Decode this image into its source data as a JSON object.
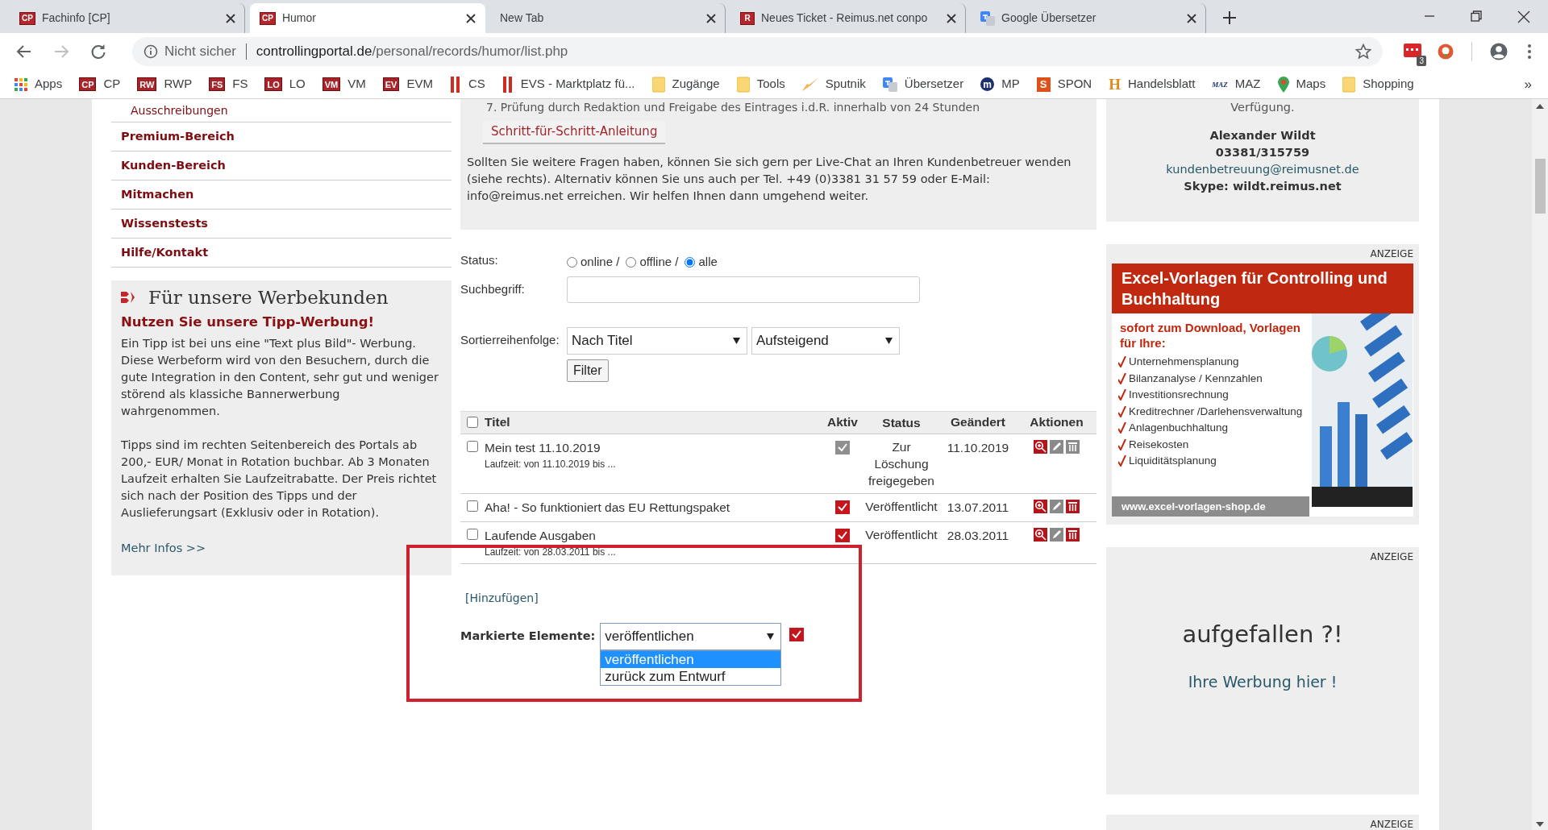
{
  "browser": {
    "tabs": [
      {
        "title": "Fachinfo [CP]",
        "kind": "badge",
        "favicon_text": "CP",
        "selected": false
      },
      {
        "title": "Humor",
        "kind": "badge",
        "favicon_text": "CP",
        "selected": true
      },
      {
        "title": "New Tab",
        "kind": "plain",
        "selected": false
      },
      {
        "title": "Neues Ticket - Reimus.net conpo",
        "kind": "badge",
        "favicon_text": "R",
        "selected": false
      },
      {
        "title": "Google Übersetzer",
        "kind": "translate",
        "selected": false
      }
    ],
    "address": {
      "security": "Nicht sicher",
      "host": "controllingportal.de",
      "path": "/personal/records/humor/list.php"
    },
    "extension_badge": "3",
    "bookmarks": [
      {
        "label": "Apps",
        "kind": "apps"
      },
      {
        "label": "CP",
        "kind": "badge",
        "icon_text": "CP"
      },
      {
        "label": "RWP",
        "kind": "badge",
        "icon_text": "RW"
      },
      {
        "label": "FS",
        "kind": "badge",
        "icon_text": "FS"
      },
      {
        "label": "LO",
        "kind": "badge",
        "icon_text": "LO"
      },
      {
        "label": "VM",
        "kind": "badge",
        "icon_text": "VM"
      },
      {
        "label": "EVM",
        "kind": "badge",
        "icon_text": "EV"
      },
      {
        "label": "CS",
        "kind": "bars"
      },
      {
        "label": "EVS - Marktplatz fü...",
        "kind": "bars"
      },
      {
        "label": "Zugänge",
        "kind": "folder"
      },
      {
        "label": "Tools",
        "kind": "folder"
      },
      {
        "label": "Sputnik",
        "kind": "plane"
      },
      {
        "label": "Übersetzer",
        "kind": "translate"
      },
      {
        "label": "MP",
        "kind": "round",
        "icon_text": "m"
      },
      {
        "label": "SPON",
        "kind": "square",
        "icon_text": "S"
      },
      {
        "label": "Handelsblatt",
        "kind": "serif",
        "icon_text": "H"
      },
      {
        "label": "MAZ",
        "kind": "wordmark",
        "icon_text": "MAZ"
      },
      {
        "label": "Maps",
        "kind": "pin"
      },
      {
        "label": "Shopping",
        "kind": "folder"
      }
    ],
    "bookmarks_overflow": "»"
  },
  "sidebar": {
    "nav": [
      {
        "label": "Ausschreibungen",
        "kind": "sub"
      },
      {
        "label": "Premium-Bereich",
        "kind": "main"
      },
      {
        "label": "Kunden-Bereich",
        "kind": "main"
      },
      {
        "label": "Mitmachen",
        "kind": "main"
      },
      {
        "label": "Wissenstests",
        "kind": "main"
      },
      {
        "label": "Hilfe/Kontakt",
        "kind": "main"
      }
    ],
    "promo": {
      "title": "Für unsere Werbekunden",
      "headline": "Nutzen Sie unsere Tipp-Werbung!",
      "paragraphs": [
        "Ein Tipp ist bei uns eine \"Text plus Bild\"- Werbung. Diese Werbeform wird von den Besuchern, durch die gute Integration in den Content, sehr gut und weniger störend als klassiche Bannerwerbung wahrgenommen.",
        "Tipps sind im rechten Seitenbereich des Portals ab 200,- EUR/ Monat in Rotation buchbar.  Ab 3 Monaten Laufzeit erhalten Sie Laufzeitrabatte. Der Preis richtet sich nach der Position des Tipps und der Auslieferungsart (Exklusiv oder in Rotation)."
      ],
      "link": "Mehr Infos >>"
    }
  },
  "info": {
    "cut_line": "7. Prüfung durch Redaktion und Freigabe des Eintrages i.d.R. innerhalb von 24 Stunden",
    "button": "Schritt-für-Schritt-Anleitung",
    "text": "Sollten Sie weitere Fragen haben, können Sie sich gern per Live-Chat an Ihren Kundenbetreuer wenden (siehe rechts). Alternativ können Sie uns auch per Tel. +49 (0)3381 31 57 59 oder E-Mail: info@reimus.net erreichen. Wir helfen Ihnen dann umgehend weiter."
  },
  "filter": {
    "status_label": "Status:",
    "radios": [
      {
        "label": "online /",
        "selected": false
      },
      {
        "label": "offline /",
        "selected": false
      },
      {
        "label": "alle",
        "selected": true
      }
    ],
    "search_label": "Suchbegriff:",
    "sort_label": "Sortierreihenfolge:",
    "sort_field": "Nach Titel",
    "sort_order": "Aufsteigend",
    "button": "Filter"
  },
  "table": {
    "all_checked": false,
    "columns": [
      "Titel",
      "Aktiv",
      "Status",
      "Geändert",
      "Aktionen"
    ],
    "rows": [
      {
        "title": "Mein test 11.10.2019",
        "runtime": "Laufzeit:  von 11.10.2019 bis ...",
        "checked": false,
        "active": false,
        "status": "Zur Löschung freigegeben",
        "changed": "11.10.2019",
        "deletable": false
      },
      {
        "title": "Aha! - So funktioniert das EU Rettungspaket",
        "checked": false,
        "active": true,
        "status": "Veröffentlicht",
        "changed": "13.07.2011",
        "deletable": true
      },
      {
        "title": "Laufende Ausgaben",
        "runtime": "Laufzeit:  von 28.03.2011 bis ...",
        "checked": false,
        "active": true,
        "status": "Veröffentlicht",
        "changed": "28.03.2011",
        "deletable": true
      }
    ]
  },
  "bulk": {
    "add_link": "[Hinzufügen]",
    "label": "Markierte Elemente:",
    "value": "veröffentlichen",
    "expanded": true,
    "options": [
      {
        "label": "veröffentlichen",
        "selected": true
      },
      {
        "label": "zurück zum Entwurf",
        "selected": false
      }
    ]
  },
  "contact": {
    "cut_line": "Verfügung.",
    "name": "Alexander Wildt",
    "phone": "03381/315759",
    "email": "kundenbetreuung@reimusnet.de",
    "skype": "Skype: wildt.reimus.net"
  },
  "ads": [
    {
      "kind": "banner",
      "label": "ANZEIGE",
      "title": "Excel-Vorlagen für Controlling und Buchhaltung",
      "subtitle": "sofort zum Download, Vorlagen für Ihre:",
      "items": [
        "Unternehmensplanung",
        "Bilanzanalyse / Kennzahlen",
        "Investitionsrechnung",
        "Kreditrechner /Darlehensverwaltung",
        "Anlagenbuchhaltung",
        "Reisekosten",
        "Liquiditätsplanung"
      ],
      "url": "www.excel-vorlagen-shop.de"
    },
    {
      "kind": "text",
      "label": "ANZEIGE",
      "headline": "aufgefallen ?!",
      "link": "Ihre Werbung hier !"
    },
    {
      "kind": "empty",
      "label": "ANZEIGE"
    }
  ]
}
